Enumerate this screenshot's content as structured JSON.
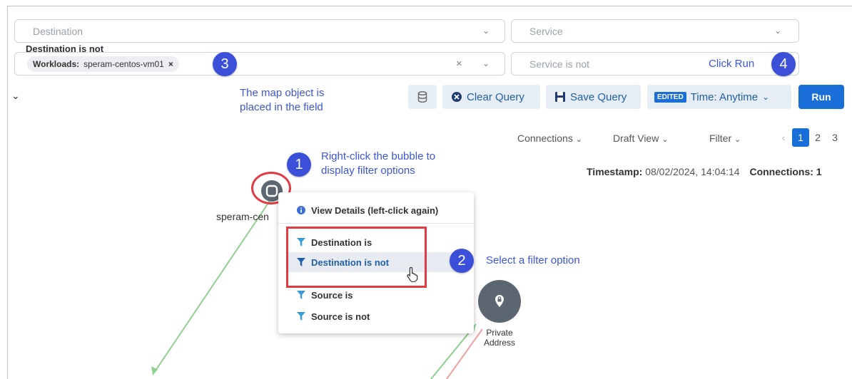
{
  "query": {
    "destination_placeholder": "Destination",
    "service_placeholder": "Service",
    "destination_not_label": "Destination is not",
    "chip_type": "Workloads:",
    "chip_value": "speram-centos-vm01",
    "chip_remove": "×",
    "clear_glyph": "×",
    "service_not_placeholder": "Service is not"
  },
  "annotations": {
    "step1_number": "1",
    "step1_text_line1": "Right-click the bubble to",
    "step1_text_line2": "display filter options",
    "step2_number": "2",
    "step2_text": "Select a filter option",
    "step3_number": "3",
    "step3_text_line1": "The map object is",
    "step3_text_line2": "placed in the field",
    "step4_number": "4",
    "step4_text": "Click Run"
  },
  "toolbar": {
    "clear_query": "Clear Query",
    "save_query": "Save Query",
    "edited_badge": "EDITED",
    "time_label": "Time: Anytime",
    "run": "Run"
  },
  "map_controls": {
    "connections": "Connections",
    "draft_view": "Draft View",
    "filter": "Filter",
    "prev": "‹",
    "pages": [
      "1",
      "2",
      "3"
    ],
    "timestamp_label": "Timestamp:",
    "timestamp_value": "08/02/2024, 14:04:14",
    "connections_label": "Connections: 1"
  },
  "context_menu": {
    "view_details": "View Details (left-click again)",
    "destination_is": "Destination is",
    "destination_is_not": "Destination is not",
    "source_is": "Source is",
    "source_is_not": "Source is not"
  },
  "nodes": {
    "workload_label": "speram-cen",
    "private_label_line1": "Private",
    "private_label_line2": "Address"
  },
  "colors": {
    "accent": "#1a6ed8",
    "badge": "#3b4fd8",
    "annotation_text": "#3d56d6",
    "highlight_box": "#e03a43",
    "node": "#5c6670",
    "edge_green": "#8fd08f",
    "edge_red": "#f0a0a0"
  }
}
